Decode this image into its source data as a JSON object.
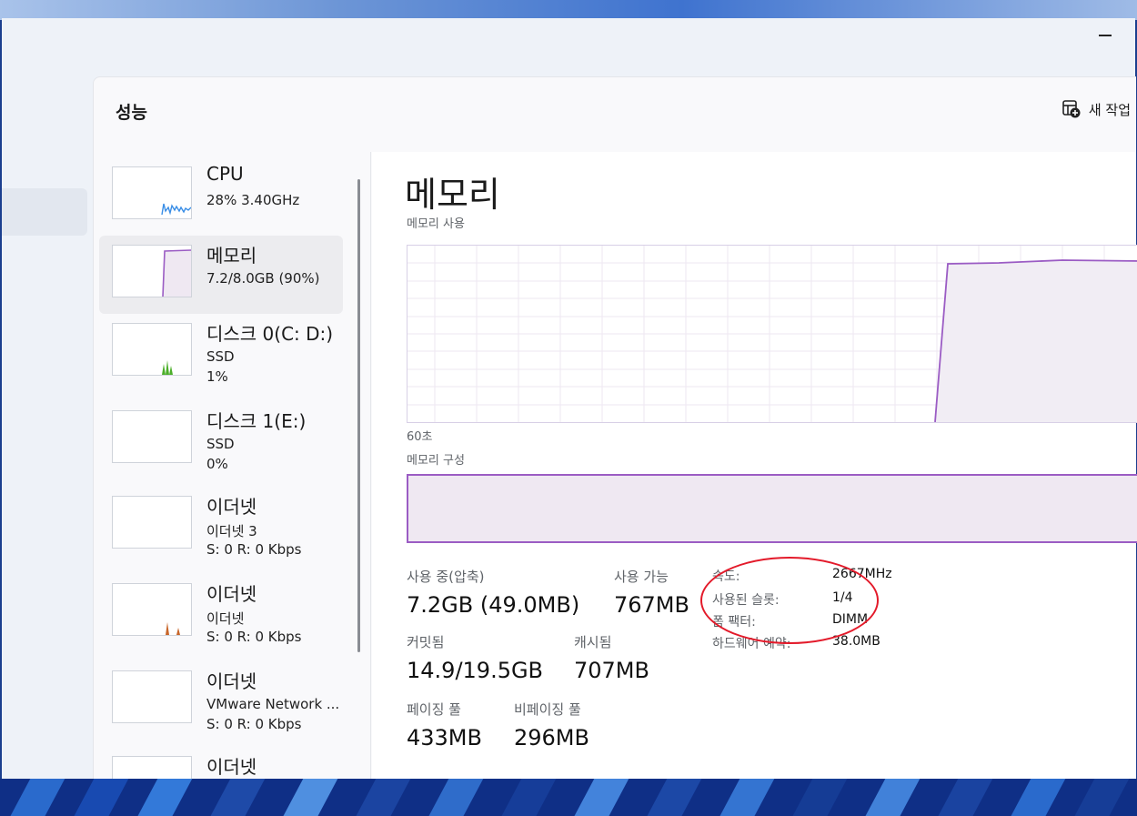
{
  "panel": {
    "title": "성능",
    "new_task_label": "새 작업"
  },
  "sidebar": {
    "items": [
      {
        "name": "CPU",
        "sub1": "28% 3.40GHz"
      },
      {
        "name": "메모리",
        "sub1": "7.2/8.0GB (90%)"
      },
      {
        "name": "디스크 0(C: D:)",
        "sub1": "SSD",
        "sub2": "1%"
      },
      {
        "name": "디스크 1(E:)",
        "sub1": "SSD",
        "sub2": "0%"
      },
      {
        "name": "이더넷",
        "sub1": "이더넷 3",
        "sub2": "S: 0 R: 0 Kbps"
      },
      {
        "name": "이더넷",
        "sub1": "이더넷",
        "sub2": "S: 0 R: 0 Kbps"
      },
      {
        "name": "이더넷",
        "sub1": "VMware Network ...",
        "sub2": "S: 0 R: 0 Kbps"
      },
      {
        "name": "이더넷"
      }
    ]
  },
  "main": {
    "title": "메모리",
    "usage_label": "메모리 사용",
    "time_label": "60초",
    "composition_label": "메모리 구성",
    "stats": {
      "in_use_label": "사용 중(압축)",
      "in_use_value": "7.2GB (49.0MB)",
      "available_label": "사용 가능",
      "available_value": "767MB",
      "committed_label": "커밋됨",
      "committed_value": "14.9/19.5GB",
      "cached_label": "캐시됨",
      "cached_value": "707MB",
      "paged_pool_label": "페이징 풀",
      "paged_pool_value": "433MB",
      "nonpaged_pool_label": "비페이징 풀",
      "nonpaged_pool_value": "296MB"
    },
    "details": {
      "speed_label": "속도:",
      "speed_value": "2667MHz",
      "slots_label": "사용된 슬롯:",
      "slots_value": "1/4",
      "form_factor_label": "폼 팩터:",
      "form_factor_value": "DIMM",
      "reserved_label": "하드웨어 예약:",
      "reserved_value": "38.0MB"
    }
  },
  "colors": {
    "memory": "#9b5cc4",
    "cpu": "#3a8ee6",
    "disk": "#4caf2a",
    "ethernet": "#c8662a",
    "annotation": "#e31a2a"
  }
}
